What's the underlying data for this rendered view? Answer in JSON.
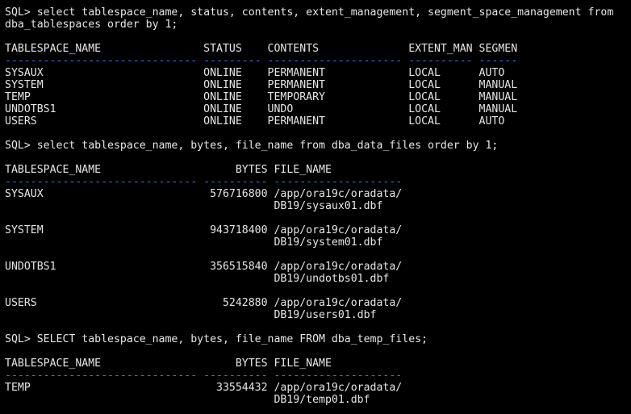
{
  "terminal": {
    "colors": {
      "background": "#000000",
      "text": "#e6e6e6",
      "separator": "#3a79f0"
    },
    "lines": [
      {
        "text": "SQL> select tablespace_name, status, contents, extent_management, segment_space_management from",
        "kind": "text"
      },
      {
        "text": "dba_tablespaces order by 1;",
        "kind": "text"
      },
      {
        "text": "",
        "kind": "blank"
      },
      {
        "text": "TABLESPACE_NAME                STATUS    CONTENTS              EXTENT_MAN SEGMEN",
        "kind": "text"
      },
      {
        "text": "------------------------------ --------- --------------------- ---------- ------",
        "kind": "sep"
      },
      {
        "text": "SYSAUX                         ONLINE    PERMANENT             LOCAL      AUTO",
        "kind": "text"
      },
      {
        "text": "SYSTEM                         ONLINE    PERMANENT             LOCAL      MANUAL",
        "kind": "text"
      },
      {
        "text": "TEMP                           ONLINE    TEMPORARY             LOCAL      MANUAL",
        "kind": "text"
      },
      {
        "text": "UNDOTBS1                       ONLINE    UNDO                  LOCAL      MANUAL",
        "kind": "text"
      },
      {
        "text": "USERS                          ONLINE    PERMANENT             LOCAL      AUTO",
        "kind": "text"
      },
      {
        "text": "",
        "kind": "blank"
      },
      {
        "text": "SQL> select tablespace_name, bytes, file_name from dba_data_files order by 1;",
        "kind": "text"
      },
      {
        "text": "",
        "kind": "blank"
      },
      {
        "text": "TABLESPACE_NAME                     BYTES FILE_NAME",
        "kind": "text"
      },
      {
        "text": "------------------------------ ---------- --------------------",
        "kind": "sep"
      },
      {
        "text": "SYSAUX                          576716800 /app/ora19c/oradata/",
        "kind": "text"
      },
      {
        "text": "                                          DB19/sysaux01.dbf",
        "kind": "text"
      },
      {
        "text": "",
        "kind": "blank"
      },
      {
        "text": "SYSTEM                          943718400 /app/ora19c/oradata/",
        "kind": "text"
      },
      {
        "text": "                                          DB19/system01.dbf",
        "kind": "text"
      },
      {
        "text": "",
        "kind": "blank"
      },
      {
        "text": "UNDOTBS1                        356515840 /app/ora19c/oradata/",
        "kind": "text"
      },
      {
        "text": "                                          DB19/undotbs01.dbf",
        "kind": "text"
      },
      {
        "text": "",
        "kind": "blank"
      },
      {
        "text": "USERS                             5242880 /app/ora19c/oradata/",
        "kind": "text"
      },
      {
        "text": "                                          DB19/users01.dbf",
        "kind": "text"
      },
      {
        "text": "",
        "kind": "blank"
      },
      {
        "text": "SQL> SELECT tablespace_name, bytes, file_name FROM dba_temp_files;",
        "kind": "text"
      },
      {
        "text": "",
        "kind": "blank"
      },
      {
        "text": "TABLESPACE_NAME                     BYTES FILE_NAME",
        "kind": "text"
      },
      {
        "text": "------------------------------ ---------- --------------------",
        "kind": "sep"
      },
      {
        "text": "TEMP                             33554432 /app/ora19c/oradata/",
        "kind": "text"
      },
      {
        "text": "                                          DB19/temp01.dbf",
        "kind": "text"
      }
    ]
  }
}
